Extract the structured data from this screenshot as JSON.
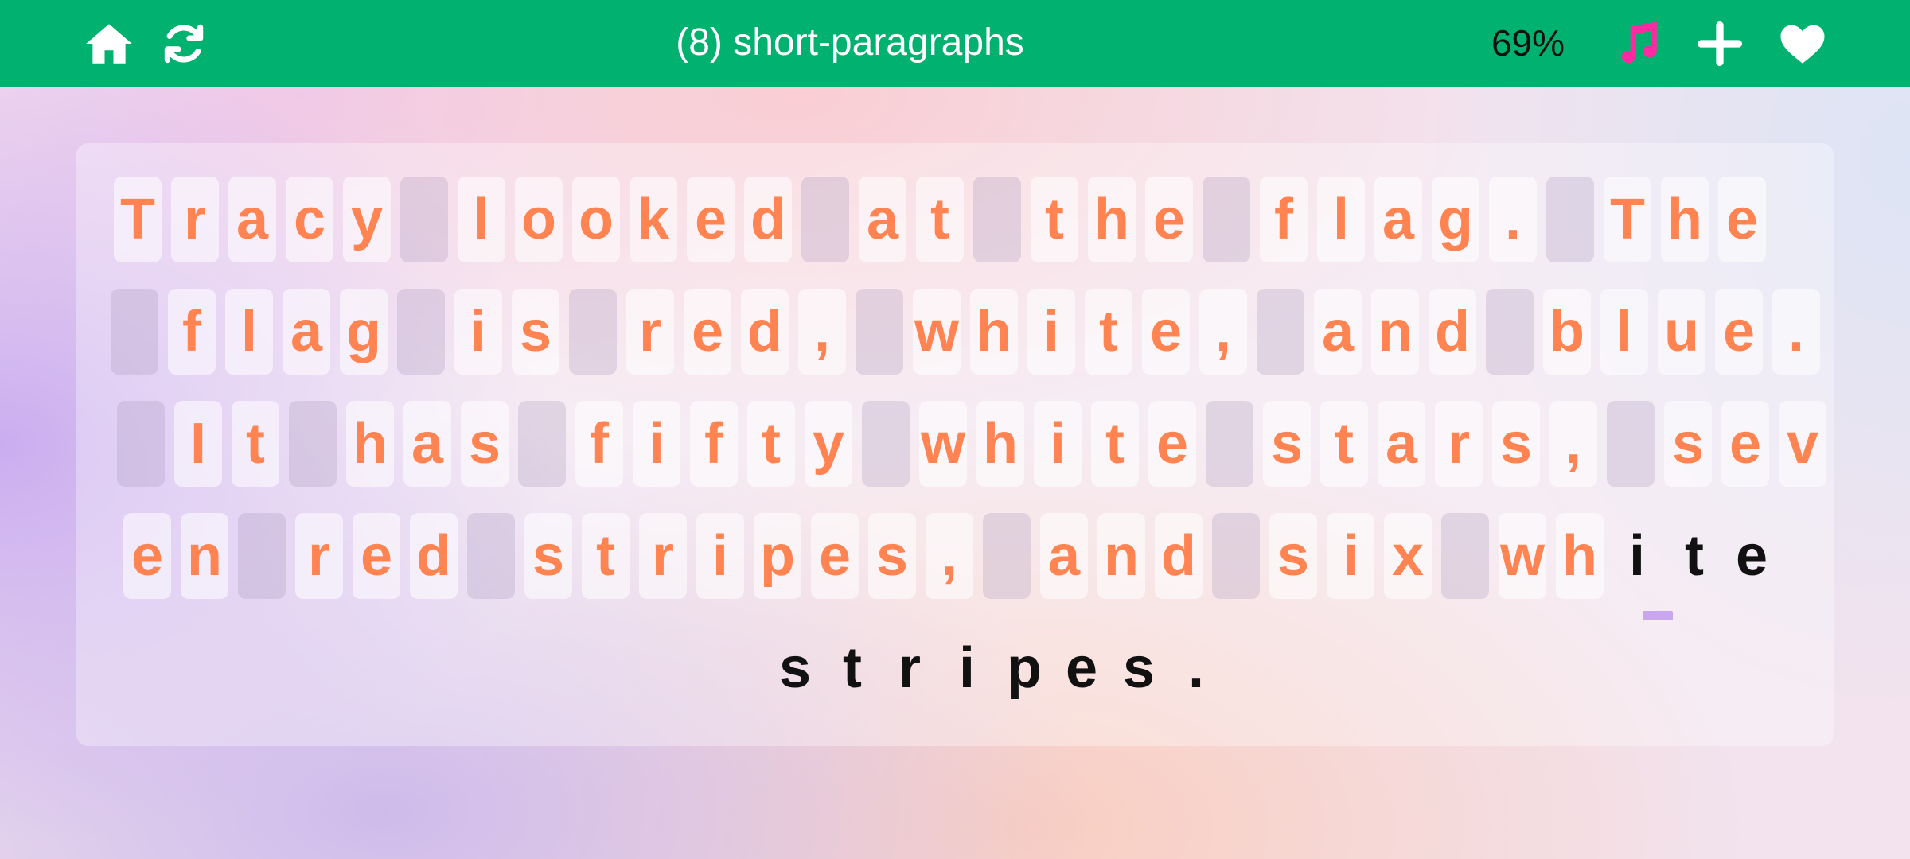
{
  "header": {
    "title": "(8) short-paragraphs",
    "percent": "69%",
    "icons": {
      "home": "home-icon",
      "restart": "refresh-icon",
      "music": "music-note-icon",
      "add": "plus-icon",
      "favorite": "heart-icon"
    },
    "colors": {
      "bar": "#00b170",
      "music": "#ff2aa1",
      "typed_text": "#ff8452",
      "pending_text": "#111111",
      "caret": "#c9a6f0"
    }
  },
  "passage": {
    "typed": "Tracy looked at the flag. The flag is red, white, and blue. It has fifty white stars, seven red stripes, and six wh",
    "remaining": "ite stripes.",
    "lines": [
      "Tracy looked at the flag. The",
      " flag is red, white, and blue.",
      " It has fifty white stars, sev",
      "en red stripes, and six white",
      "stripes."
    ]
  }
}
